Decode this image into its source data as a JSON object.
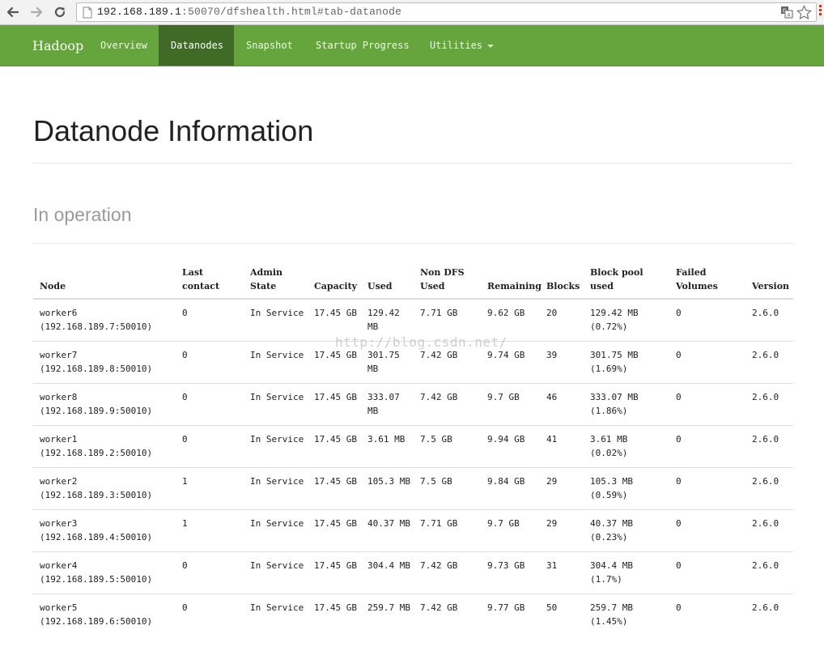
{
  "browser": {
    "url_host": "192.168.189.1",
    "url_rest": ":50070/dfshealth.html#tab-datanode"
  },
  "navbar": {
    "brand": "Hadoop",
    "items": [
      {
        "label": "Overview"
      },
      {
        "label": "Datanodes"
      },
      {
        "label": "Snapshot"
      },
      {
        "label": "Startup Progress"
      },
      {
        "label": "Utilities"
      }
    ],
    "active_color": "#3f6b27",
    "bar_color": "#66a43e"
  },
  "page": {
    "title": "Datanode Information",
    "section": "In operation"
  },
  "table": {
    "headers": {
      "node": "Node",
      "last_contact": "Last contact",
      "admin_state": "Admin State",
      "capacity": "Capacity",
      "used": "Used",
      "non_dfs_used": "Non DFS Used",
      "remaining": "Remaining",
      "blocks": "Blocks",
      "block_pool_used": "Block pool used",
      "failed_volumes": "Failed Volumes",
      "version": "Version"
    },
    "rows": [
      {
        "node": "worker6 (192.168.189.7:50010)",
        "last_contact": "0",
        "admin_state": "In Service",
        "capacity": "17.45 GB",
        "used": "129.42 MB",
        "non_dfs_used": "7.71 GB",
        "remaining": "9.62 GB",
        "blocks": "20",
        "block_pool_used": "129.42 MB (0.72%)",
        "failed_volumes": "0",
        "version": "2.6.0"
      },
      {
        "node": "worker7 (192.168.189.8:50010)",
        "last_contact": "0",
        "admin_state": "In Service",
        "capacity": "17.45 GB",
        "used": "301.75 MB",
        "non_dfs_used": "7.42 GB",
        "remaining": "9.74 GB",
        "blocks": "39",
        "block_pool_used": "301.75 MB (1.69%)",
        "failed_volumes": "0",
        "version": "2.6.0"
      },
      {
        "node": "worker8 (192.168.189.9:50010)",
        "last_contact": "0",
        "admin_state": "In Service",
        "capacity": "17.45 GB",
        "used": "333.07 MB",
        "non_dfs_used": "7.42 GB",
        "remaining": "9.7 GB",
        "blocks": "46",
        "block_pool_used": "333.07 MB (1.86%)",
        "failed_volumes": "0",
        "version": "2.6.0"
      },
      {
        "node": "worker1 (192.168.189.2:50010)",
        "last_contact": "0",
        "admin_state": "In Service",
        "capacity": "17.45 GB",
        "used": "3.61 MB",
        "non_dfs_used": "7.5 GB",
        "remaining": "9.94 GB",
        "blocks": "41",
        "block_pool_used": "3.61 MB (0.02%)",
        "failed_volumes": "0",
        "version": "2.6.0"
      },
      {
        "node": "worker2 (192.168.189.3:50010)",
        "last_contact": "1",
        "admin_state": "In Service",
        "capacity": "17.45 GB",
        "used": "105.3 MB",
        "non_dfs_used": "7.5 GB",
        "remaining": "9.84 GB",
        "blocks": "29",
        "block_pool_used": "105.3 MB (0.59%)",
        "failed_volumes": "0",
        "version": "2.6.0"
      },
      {
        "node": "worker3 (192.168.189.4:50010)",
        "last_contact": "1",
        "admin_state": "In Service",
        "capacity": "17.45 GB",
        "used": "40.37 MB",
        "non_dfs_used": "7.71 GB",
        "remaining": "9.7 GB",
        "blocks": "29",
        "block_pool_used": "40.37 MB (0.23%)",
        "failed_volumes": "0",
        "version": "2.6.0"
      },
      {
        "node": "worker4 (192.168.189.5:50010)",
        "last_contact": "0",
        "admin_state": "In Service",
        "capacity": "17.45 GB",
        "used": "304.4 MB",
        "non_dfs_used": "7.42 GB",
        "remaining": "9.73 GB",
        "blocks": "31",
        "block_pool_used": "304.4 MB (1.7%)",
        "failed_volumes": "0",
        "version": "2.6.0"
      },
      {
        "node": "worker5 (192.168.189.6:50010)",
        "last_contact": "0",
        "admin_state": "In Service",
        "capacity": "17.45 GB",
        "used": "259.7 MB",
        "non_dfs_used": "7.42 GB",
        "remaining": "9.77 GB",
        "blocks": "50",
        "block_pool_used": "259.7 MB (1.45%)",
        "failed_volumes": "0",
        "version": "2.6.0"
      }
    ]
  },
  "watermark": "http://blog.csdn.net/"
}
